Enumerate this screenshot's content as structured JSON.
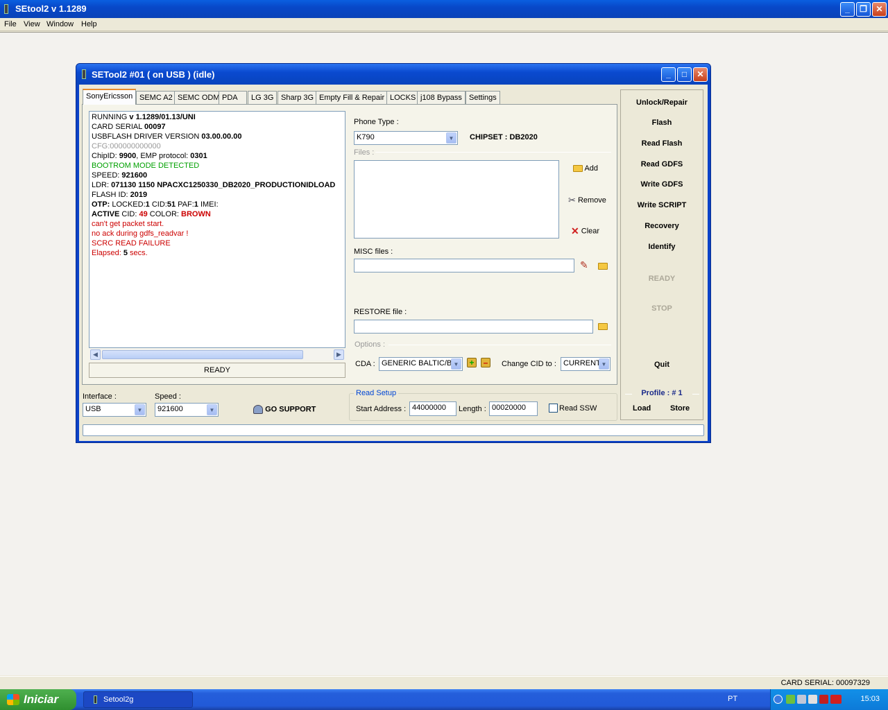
{
  "app": {
    "title": "SEtool2 v 1.1289",
    "menu": [
      "File",
      "View",
      "Window",
      "Help"
    ]
  },
  "child": {
    "title": "SETool2 #01 ( on USB ) (idle)"
  },
  "tabs": [
    "SonyEricsson",
    "SEMC A2",
    "SEMC ODM",
    "PDA",
    "LG 3G",
    "Sharp 3G",
    "Empty Fill & Repair",
    "LOCKS",
    "j108 Bypass",
    "Settings"
  ],
  "log": {
    "l1a": "RUNNING ",
    "l1b": "v 1.1289/01.13/UNI",
    "l2a": "CARD SERIAL ",
    "l2b": "00097",
    "l3a": "USBFLASH DRIVER VERSION ",
    "l3b": "03.00.00.00",
    "l4": "CFG:000000000000",
    "l5a": "ChipID: ",
    "l5b": "9900",
    "l5c": ", EMP protocol: ",
    "l5d": "0301",
    "l6": "BOOTROM MODE DETECTED",
    "l7a": "SPEED: ",
    "l7b": "921600",
    "l8a": "LDR: ",
    "l8b": "071130 1150 NPACXC1250330_DB2020_PRODUCTIONIDLOAD",
    "l9a": "FLASH ID: ",
    "l9b": "2019",
    "l10a": "OTP: ",
    "l10b": "LOCKED:",
    "l10c": "1",
    "l10d": " CID:",
    "l10e": "51",
    "l10f": " PAF:",
    "l10g": "1",
    "l10h": " IMEI:",
    "l11a": "ACTIVE ",
    "l11b": "CID: ",
    "l11c": "49",
    "l11d": " COLOR: ",
    "l11e": "BROWN",
    "l12": "can't get packet start.",
    "l13": "no ack during gdfs_readvar !",
    "l14": "SCRC READ FAILURE",
    "l15a": "Elapsed: ",
    "l15b": "5",
    "l15c": " secs."
  },
  "log_status": "READY",
  "form": {
    "phone_type_label": "Phone Type :",
    "phone_type": "K790",
    "chipset": "CHIPSET : DB2020",
    "files_label": "Files :",
    "add": "Add",
    "remove": "Remove",
    "clear": "Clear",
    "misc_label": "MISC files :",
    "restore_label": "RESTORE file :",
    "options_label": "Options :",
    "cda_label": "CDA :",
    "cda_value": "GENERIC BALTIC/BA",
    "change_cid_label": "Change CID to :",
    "change_cid_value": "CURRENT"
  },
  "side": {
    "buttons": [
      "Unlock/Repair",
      "Flash",
      "Read Flash",
      "Read GDFS",
      "Write GDFS",
      "Write SCRIPT",
      "Recovery",
      "Identify"
    ],
    "ready": "READY",
    "stop": "STOP",
    "quit": "Quit",
    "profile": "Profile :  # 1",
    "load": "Load",
    "store": "Store"
  },
  "bottom": {
    "interface_label": "Interface :",
    "interface_value": "USB",
    "speed_label": "Speed :",
    "speed_value": "921600",
    "go_support": "GO SUPPORT",
    "read_setup": "Read Setup",
    "start_label": "Start Address :",
    "start_value": "44000000",
    "length_label": "Length :",
    "length_value": "00020000",
    "read_ssw": "Read SSW"
  },
  "status": {
    "card_serial": "CARD SERIAL: 00097329"
  },
  "taskbar": {
    "start": "Iniciar",
    "task": "Setool2g",
    "lang": "PT",
    "clock": "15:03"
  },
  "colors": {
    "xp_blue": "#0a4ad0",
    "active_tab": "#e68b2c",
    "log_red": "#cc0000",
    "log_green": "#00a000"
  }
}
